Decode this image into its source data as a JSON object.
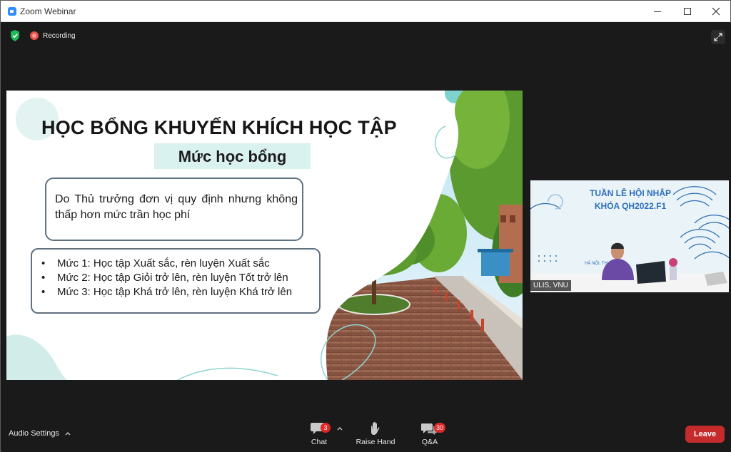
{
  "window": {
    "title": "Zoom Webinar",
    "minimize_icon": "minimize-icon",
    "maximize_icon": "maximize-icon",
    "close_icon": "close-icon"
  },
  "status": {
    "secure_icon": "shield-check-icon",
    "recording_label": "Recording",
    "fullscreen_icon": "fullscreen-icon"
  },
  "slide": {
    "title": "HỌC BỔNG KHUYẾN KHÍCH HỌC TẬP",
    "subtitle": "Mức học bổng",
    "note": "Do Thủ trưởng đơn vị quy định nhưng không thấp hơn mức trần học phí",
    "levels": [
      "Mức 1: Học tập Xuất sắc, rèn luyện Xuất sắc",
      "Mức 2: Học tập Giỏi trở lên, rèn luyện Tốt trở lên",
      "Mức 3: Học tập Khá trở lên, rèn luyện Khá trở lên"
    ]
  },
  "video": {
    "participant_name": "ULIS, VNU",
    "backdrop_line1": "TUẦN LỄ HỘI NHẬP",
    "backdrop_line2": "KHÓA QH2022.F1",
    "backdrop_small": "HÀ NỘI, TH"
  },
  "toolbar": {
    "audio_settings_label": "Audio Settings",
    "chat_label": "Chat",
    "chat_badge": "3",
    "raise_hand_label": "Raise Hand",
    "qa_label": "Q&A",
    "qa_badge": "30",
    "leave_label": "Leave"
  },
  "colors": {
    "accent": "#2d8cff",
    "leave": "#c52b2b",
    "badge": "#e02828",
    "slide_subtitle_bg": "#d9f1ef",
    "slide_teal": "#7fd3cf"
  }
}
